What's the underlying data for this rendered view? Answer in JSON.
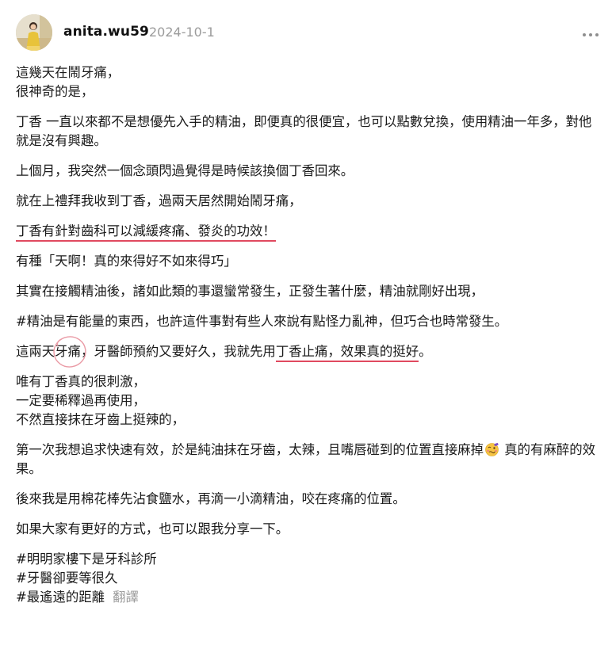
{
  "author": {
    "username": "anita.wu59",
    "date": "2024-10-1"
  },
  "icons": {
    "more": "more-horizontal-icon",
    "emoji": "woozy-face-emoji"
  },
  "colors": {
    "underline": "#e0495f",
    "meta_gray": "#9b9b9b"
  },
  "post": {
    "p1": [
      "這幾天在鬧牙痛，",
      "很神奇的是，"
    ],
    "p2": "丁香 一直以來都不是想優先入手的精油，即便真的很便宜，也可以點數兌換，使用精油一年多，對他就是沒有興趣。",
    "p3": "上個月，我突然一個念頭閃過覺得是時候該換個丁香回來。",
    "p4": "就在上禮拜我收到丁香，過兩天居然開始鬧牙痛，",
    "p5": "丁香有針對齒科可以減緩疼痛、發炎的功效！",
    "p6": "有種「天啊！真的來得好不如來得巧」",
    "p7": "其實在接觸精油後，諸如此類的事還蠻常發生，正發生著什麼，精油就剛好出現，",
    "p8": "#精油是有能量的東西，也許這件事對有些人來說有點怪力亂神，但巧合也時常發生。",
    "p9": {
      "a": "這兩天",
      "b": "牙痛",
      "c": "，牙醫師預約又要好久，我就先用",
      "d": "丁香止痛，效果真的挺好",
      "e": "。"
    },
    "p10": [
      "唯有丁香真的很刺激，",
      "一定要稀釋過再使用，",
      "不然直接抹在牙齒上挺辣的，"
    ],
    "p11": {
      "a": "第一次我想追求快速有效，於是純油抹在牙齒，太辣，且嘴唇碰到的位置直接麻掉",
      "b": " 真的有麻醉的效果。"
    },
    "p12": "後來我是用棉花棒先沾食鹽水，再滴一小滴精油，咬在疼痛的位置。",
    "p13": "如果大家有更好的方式，也可以跟我分享一下。",
    "tags": [
      "#明明家樓下是牙科診所",
      "#牙醫卻要等很久",
      "#最遙遠的距離"
    ],
    "translate_label": "翻譯"
  }
}
